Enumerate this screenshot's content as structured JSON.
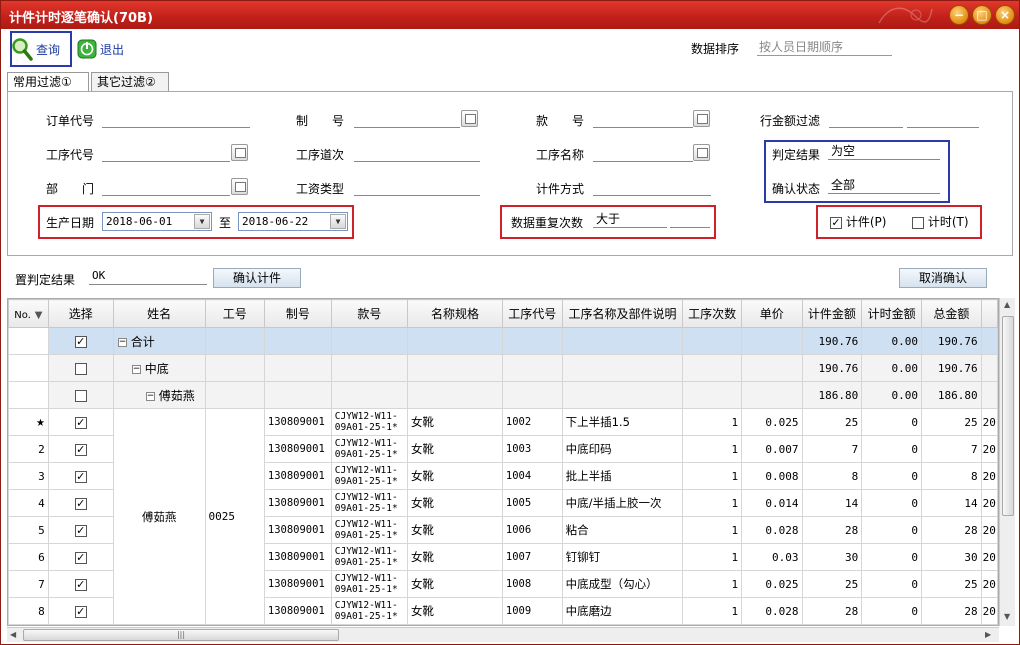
{
  "window": {
    "title": "计件计时逐笔确认(70B)",
    "min_symbol": "−",
    "max_symbol": "□",
    "close_symbol": "×"
  },
  "toolbar": {
    "query_label": "查询",
    "exit_label": "退出",
    "sort_label": "数据排序",
    "sort_value": "按人员日期顺序"
  },
  "tabs": [
    {
      "label": "常用过滤①"
    },
    {
      "label": "其它过滤②"
    }
  ],
  "filter": {
    "order_no": {
      "label": "订单代号",
      "value": ""
    },
    "make_no": {
      "label": "制　　号",
      "value": ""
    },
    "style_no": {
      "label": "款　　号",
      "value": ""
    },
    "line_amount": {
      "label": "行金额过滤",
      "value": ""
    },
    "process_code": {
      "label": "工序代号",
      "value": ""
    },
    "process_step": {
      "label": "工序道次",
      "value": ""
    },
    "process_name": {
      "label": "工序名称",
      "value": ""
    },
    "judge_result": {
      "label": "判定结果",
      "value": "为空"
    },
    "dept": {
      "label": "部　　门",
      "value": ""
    },
    "wage_type": {
      "label": "工资类型",
      "value": ""
    },
    "piece_mode": {
      "label": "计件方式",
      "value": ""
    },
    "confirm_status": {
      "label": "确认状态",
      "value": "全部"
    },
    "prod_date": {
      "label": "生产日期",
      "from": "2018-06-01",
      "to_label": "至",
      "to": "2018-06-22"
    },
    "dup_count": {
      "label": "数据重复次数",
      "value": "大于"
    },
    "piece_check": {
      "label": "计件(P)",
      "checked": true
    },
    "time_check": {
      "label": "计时(T)",
      "checked": false
    }
  },
  "mid": {
    "set_judge_label": "置判定结果",
    "set_judge_value": "OK",
    "confirm_piece_label": "确认计件",
    "cancel_confirm_label": "取消确认"
  },
  "grid": {
    "columns": [
      "No.",
      "选择",
      "姓名",
      "工号",
      "制号",
      "款号",
      "名称规格",
      "工序代号",
      "工序名称及部件说明",
      "工序次数",
      "单价",
      "计件金额",
      "计时金额",
      "总金额"
    ],
    "summary_rows": [
      {
        "tree": "合计",
        "checked": true,
        "piece_amt": "190.76",
        "time_amt": "0.00",
        "total": "190.76"
      },
      {
        "tree": "中底",
        "checked": false,
        "piece_amt": "190.76",
        "time_amt": "0.00",
        "total": "190.76"
      },
      {
        "tree": "傅茹燕",
        "checked": false,
        "piece_amt": "186.80",
        "time_amt": "0.00",
        "total": "186.80"
      }
    ],
    "person_name": "傅茹燕",
    "person_id": "0025",
    "rows": [
      {
        "no": "★",
        "make_no": "130809001",
        "style_no": "CJYW12-W11-09A01-25-1*",
        "spec": "女靴",
        "proc_code": "1002",
        "proc_name": "下上半插1.5",
        "count": "1",
        "price": "0.025",
        "piece_amt": "25",
        "time_amt": "0",
        "total": "25",
        "extra": "20"
      },
      {
        "no": "2",
        "make_no": "130809001",
        "style_no": "CJYW12-W11-09A01-25-1*",
        "spec": "女靴",
        "proc_code": "1003",
        "proc_name": "中底印码",
        "count": "1",
        "price": "0.007",
        "piece_amt": "7",
        "time_amt": "0",
        "total": "7",
        "extra": "20"
      },
      {
        "no": "3",
        "make_no": "130809001",
        "style_no": "CJYW12-W11-09A01-25-1*",
        "spec": "女靴",
        "proc_code": "1004",
        "proc_name": "批上半插",
        "count": "1",
        "price": "0.008",
        "piece_amt": "8",
        "time_amt": "0",
        "total": "8",
        "extra": "20"
      },
      {
        "no": "4",
        "make_no": "130809001",
        "style_no": "CJYW12-W11-09A01-25-1*",
        "spec": "女靴",
        "proc_code": "1005",
        "proc_name": "中底/半插上胶一次",
        "count": "1",
        "price": "0.014",
        "piece_amt": "14",
        "time_amt": "0",
        "total": "14",
        "extra": "20"
      },
      {
        "no": "5",
        "make_no": "130809001",
        "style_no": "CJYW12-W11-09A01-25-1*",
        "spec": "女靴",
        "proc_code": "1006",
        "proc_name": "粘合",
        "count": "1",
        "price": "0.028",
        "piece_amt": "28",
        "time_amt": "0",
        "total": "28",
        "extra": "20"
      },
      {
        "no": "6",
        "make_no": "130809001",
        "style_no": "CJYW12-W11-09A01-25-1*",
        "spec": "女靴",
        "proc_code": "1007",
        "proc_name": "钉铆钉",
        "count": "1",
        "price": "0.03",
        "piece_amt": "30",
        "time_amt": "0",
        "total": "30",
        "extra": "20"
      },
      {
        "no": "7",
        "make_no": "130809001",
        "style_no": "CJYW12-W11-09A01-25-1*",
        "spec": "女靴",
        "proc_code": "1008",
        "proc_name": "中底成型（勾心）",
        "count": "1",
        "price": "0.025",
        "piece_amt": "25",
        "time_amt": "0",
        "total": "25",
        "extra": "20"
      },
      {
        "no": "8",
        "make_no": "130809001",
        "style_no": "CJYW12-W11-09A01-25-1*",
        "spec": "女靴",
        "proc_code": "1009",
        "proc_name": "中底磨边",
        "count": "1",
        "price": "0.028",
        "piece_amt": "28",
        "time_amt": "0",
        "total": "28",
        "extra": "20"
      }
    ]
  },
  "colors": {
    "titlebar": "#c0201a",
    "highlight_red": "#d0202a",
    "highlight_blue": "#2a3aa8",
    "summary_row": "#cfe0f3"
  },
  "icons": [
    "search-icon",
    "exit-icon",
    "filter-icon",
    "calendar-picker-icon",
    "dropdown-arrow-icon",
    "star-icon"
  ]
}
